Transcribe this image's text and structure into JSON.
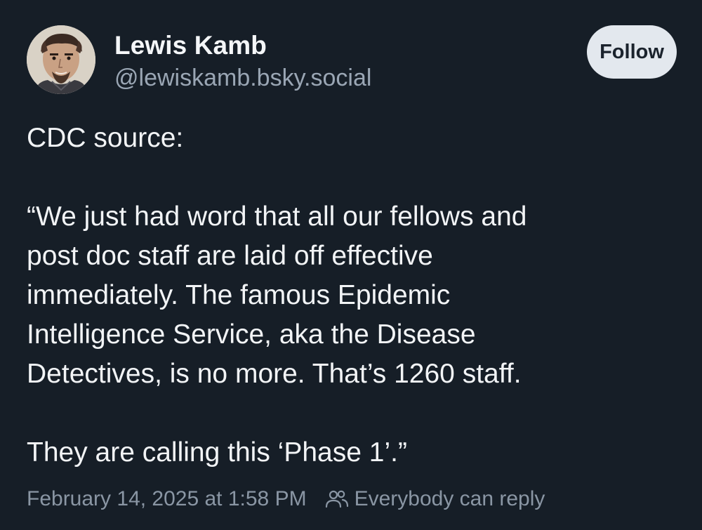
{
  "author": {
    "name": "Lewis Kamb",
    "handle": "@lewiskamb.bsky.social",
    "avatar": "avatar-portrait-icon"
  },
  "actions": {
    "follow_label": "Follow"
  },
  "post": {
    "paragraphs": [
      "CDC source:",
      "“We just had word that all our fellows and\npost doc staff are laid off effective\nimmediately.  The famous Epidemic\nIntelligence Service, aka the Disease\nDetectives, is no more.  That’s 1260 staff.",
      "They are calling this ‘Phase 1’.”"
    ]
  },
  "meta": {
    "timestamp": "February 14, 2025 at 1:58 PM",
    "reply_icon": "people-icon",
    "reply_setting": "Everybody can reply"
  },
  "colors": {
    "background": "#161e27",
    "text": "#f2f4f6",
    "muted": "#9aa6b4",
    "follow_bg": "#e3e8ee"
  }
}
